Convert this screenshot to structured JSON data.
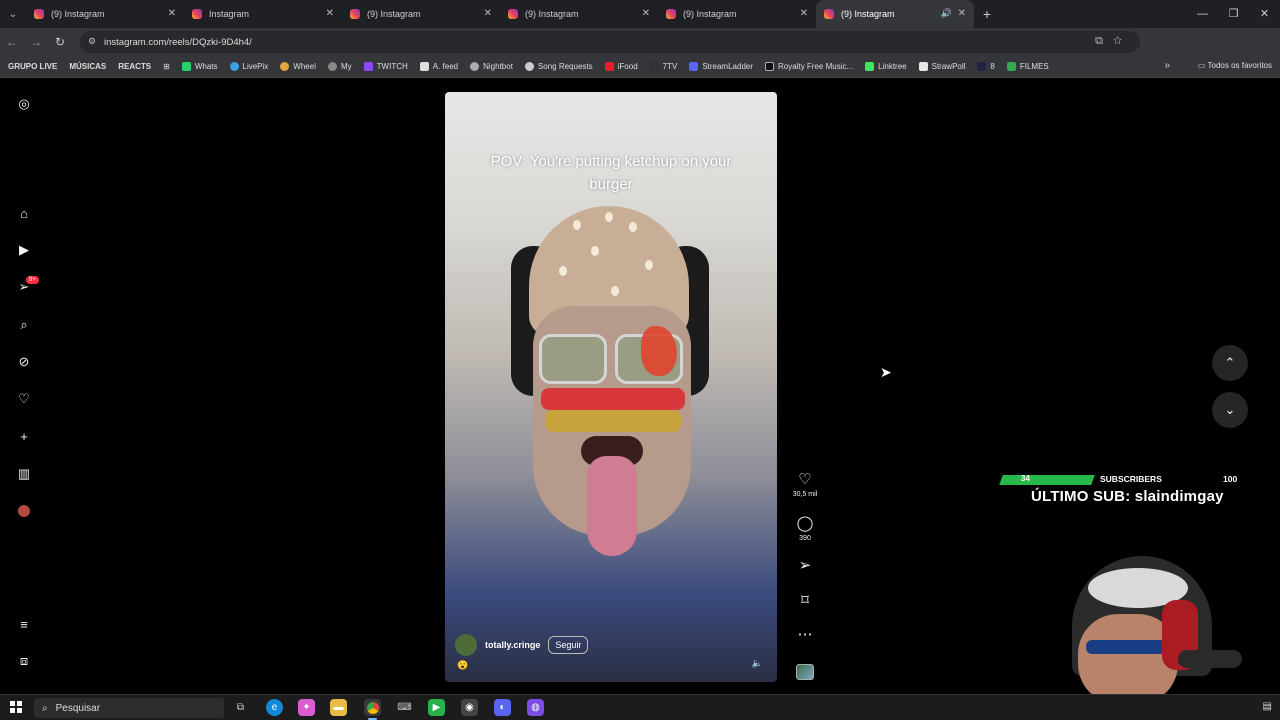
{
  "browser": {
    "tabs": [
      {
        "title": "(9) Instagram",
        "active": false
      },
      {
        "title": "Instagram",
        "active": false
      },
      {
        "title": "(9) Instagram",
        "active": false
      },
      {
        "title": "(9) Instagram",
        "active": false
      },
      {
        "title": "(9) Instagram",
        "active": false
      },
      {
        "title": "(9) Instagram",
        "active": true
      }
    ],
    "url": "instagram.com/reels/DQzki-9D4h4/",
    "bookmarks": [
      {
        "label": "GRUPO LIVE",
        "bold": true
      },
      {
        "label": "MÚSICAS",
        "bold": true
      },
      {
        "label": "REACTS",
        "bold": true
      },
      {
        "label": "Whats"
      },
      {
        "label": "LivePix"
      },
      {
        "label": "Wheel"
      },
      {
        "label": "My"
      },
      {
        "label": "TWITCH"
      },
      {
        "label": "A. feed"
      },
      {
        "label": "Nightbot"
      },
      {
        "label": "Song Requests"
      },
      {
        "label": "iFood"
      },
      {
        "label": "7TV"
      },
      {
        "label": "StreamLadder"
      },
      {
        "label": "Royalty Free Music..."
      },
      {
        "label": "Linktree"
      },
      {
        "label": "StrawPoll"
      },
      {
        "label": "8"
      },
      {
        "label": "FILMES"
      }
    ],
    "bookmarks_right": "Todos os favoritos"
  },
  "instagram": {
    "notification_badge": "9+",
    "reel": {
      "caption": "POV: You're putting ketchup on your burger",
      "username": "totally.cringe",
      "follow_label": "Seguir",
      "likes": "30,5 mil",
      "comments": "390"
    }
  },
  "overlay": {
    "subs_current": "34",
    "subs_label": "SUBSCRIBERS",
    "subs_goal": "100",
    "subs_progress_fraction": 0.34,
    "last_sub": "ÚLTIMO SUB: slaindimgay"
  },
  "taskbar": {
    "search_placeholder": "Pesquisar"
  },
  "colors": {
    "follow_progress": "#28b94c",
    "badge": "#ff3040",
    "tab_active": "#35363a"
  }
}
